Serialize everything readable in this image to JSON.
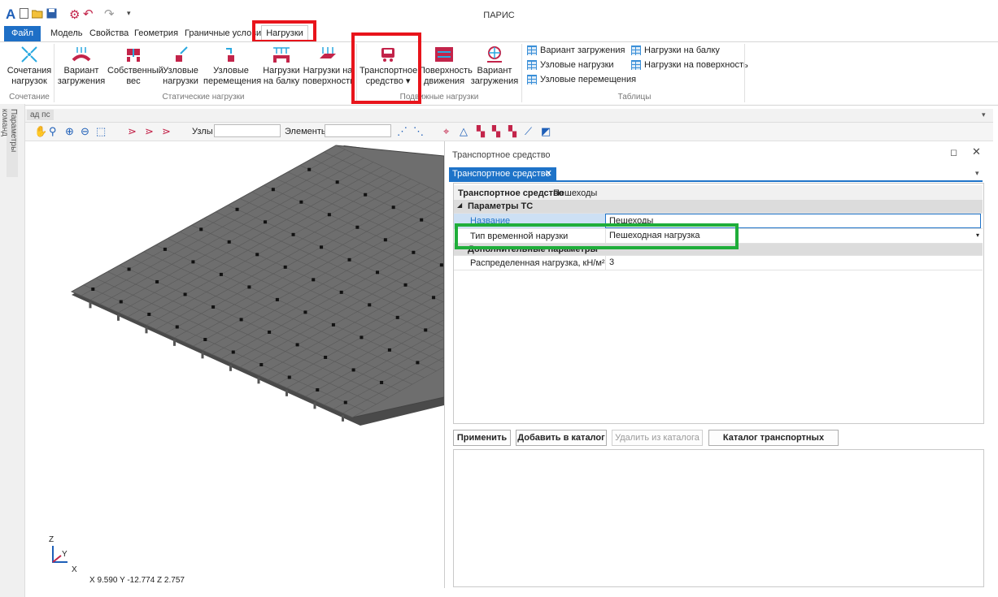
{
  "app": {
    "title": "ПАРИС",
    "accent": "#1e6fc6"
  },
  "quick_access": [
    "app-logo-icon",
    "new-icon",
    "open-icon",
    "save-icon",
    "settings-icon",
    "undo-icon",
    "redo-icon",
    "customize-icon"
  ],
  "tabs": [
    {
      "label": "Файл"
    },
    {
      "label": "Модель"
    },
    {
      "label": "Свойства"
    },
    {
      "label": "Геометрия"
    },
    {
      "label": "Граничные услови"
    },
    {
      "label": "Нагрузки"
    }
  ],
  "ribbon": {
    "combo": {
      "line1": "Сочетания",
      "line2": "нагрузок"
    },
    "variant": {
      "line1": "Вариант",
      "line2": "загружения"
    },
    "selfweight": {
      "line1": "Собственный",
      "line2": "вес"
    },
    "nodal": {
      "line1": "Узловые",
      "line2": "нагрузки"
    },
    "nodal_disp": {
      "line1": "Узловые",
      "line2": "перемещения"
    },
    "beam": {
      "line1": "Нагрузки",
      "line2": "на балку"
    },
    "surface": {
      "line1": "Нагрузки на",
      "line2": "поверхность"
    },
    "vehicle": {
      "line1": "Транспортное",
      "line2": "средство ▾"
    },
    "traffic_surface": {
      "line1": "Поверхность",
      "line2": "движения"
    },
    "moving_variant": {
      "line1": "Вариант",
      "line2": "загружения"
    },
    "groups": {
      "combo": "Сочетание",
      "static": "Статические нагрузки",
      "moving": "Подвижные нагрузки",
      "tables": "Таблицы"
    },
    "tables": [
      {
        "label": "Вариант загружения"
      },
      {
        "label": "Узловые нагрузки"
      },
      {
        "label": "Узловые перемещения"
      },
      {
        "label": "Нагрузки на балку"
      },
      {
        "label": "Нагрузки на поверхность"
      }
    ]
  },
  "side_panel": {
    "label": "Параметры команд"
  },
  "doc_tab": {
    "label": "ад пс"
  },
  "toolbar": {
    "nodes_label": "Узлы",
    "nodes_value": "",
    "elements_label": "Элементы",
    "elements_value": ""
  },
  "viewport": {
    "axis_z": "Z",
    "axis_y": "Y",
    "axis_x": "X",
    "coords": "X 9.590   Y -12.774   Z 2.757"
  },
  "panel": {
    "title": "Транспортное средство",
    "tab_label": "Транспортное средство",
    "header_bold": "Транспортное средство",
    "header_value": "Пешеходы",
    "section1": "Параметры ТС",
    "row_name_label": "Название",
    "row_name_value": "Пешеходы",
    "row_type_label": "Тип временной нарузки",
    "row_type_value": "Пешеходная нагрузка",
    "section2": "Дополнительные параметры",
    "row_load_label": "Распределенная нагрузка, кН/м²",
    "row_load_value": "3",
    "buttons": {
      "apply": "Применить",
      "add": "Добавить в каталог",
      "remove": "Удалить из каталога",
      "catalog": "Каталог транспортных средств"
    }
  }
}
